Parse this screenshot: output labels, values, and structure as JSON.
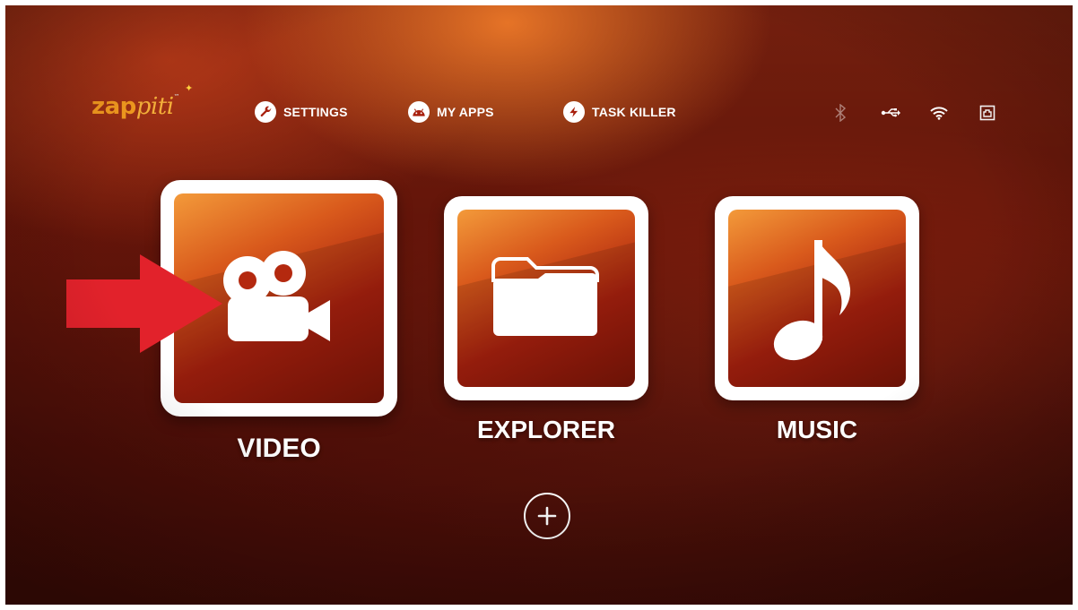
{
  "logo": {
    "main": "zap",
    "script": "pi",
    "script2": "ti",
    "tm": "™"
  },
  "menu": {
    "settings": {
      "label": "SETTINGS",
      "icon": "wrench-icon"
    },
    "my_apps": {
      "label": "MY APPS",
      "icon": "android-icon"
    },
    "task_killer": {
      "label": "TASK KILLER",
      "icon": "lightning-icon"
    }
  },
  "status": [
    "bluetooth-icon",
    "usb-icon",
    "wifi-icon",
    "ethernet-icon"
  ],
  "tiles": [
    {
      "label": "VIDEO",
      "icon": "video-camera-icon",
      "selected": true
    },
    {
      "label": "EXPLORER",
      "icon": "folder-icon",
      "selected": false
    },
    {
      "label": "MUSIC",
      "icon": "music-note-icon",
      "selected": false
    }
  ],
  "add_button": {
    "icon": "plus-icon"
  },
  "colors": {
    "accent": "#f39a1f",
    "arrow": "#e2222b",
    "tile_border": "#ffffff"
  }
}
